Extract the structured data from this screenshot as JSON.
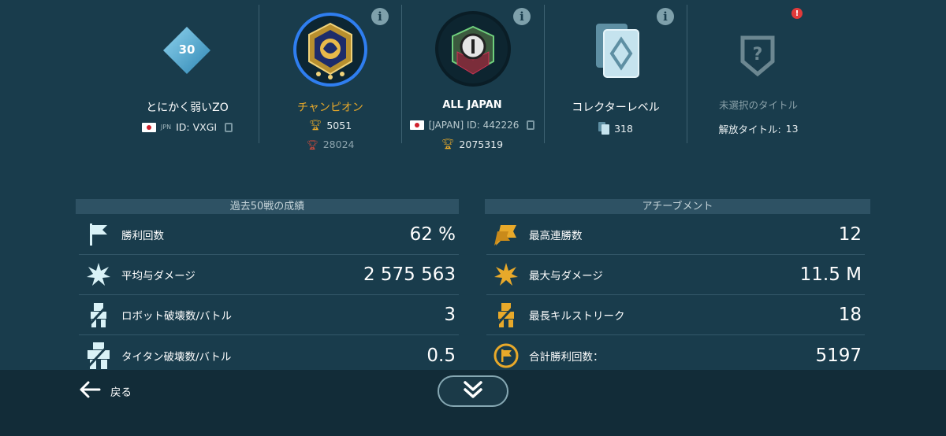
{
  "player": {
    "level": "30",
    "name": "とにかく弱いZO",
    "country_code": "JPN",
    "id_text": "ID: VXGI"
  },
  "league": {
    "name": "チャンピオン",
    "trophies": "5051",
    "best_trophies": "28024"
  },
  "clan": {
    "name": "ALL JAPAN",
    "id_text": "[JAPAN] ID: 442226",
    "trophies": "2075319"
  },
  "collector": {
    "title": "コレクターレベル",
    "value": "318"
  },
  "title_slot": {
    "label": "未選択のタイトル",
    "unlocked_label": "解放タイトル:",
    "unlocked_count": "13",
    "alert": "!"
  },
  "info_icon": "i",
  "last50": {
    "header": "過去50戦の成績",
    "rows": [
      {
        "label": "勝利回数",
        "value": "62 %",
        "icon": "flag-icon"
      },
      {
        "label": "平均与ダメージ",
        "value": "2 575 563",
        "icon": "explosion-icon"
      },
      {
        "label": "ロボット破壊数/バトル",
        "value": "3",
        "icon": "robot-icon"
      },
      {
        "label": "タイタン破壊数/バトル",
        "value": "0.5",
        "icon": "titan-icon"
      }
    ]
  },
  "achievements": {
    "header": "アチーブメント",
    "rows": [
      {
        "label": "最高連勝数",
        "value": "12",
        "icon": "flags-icon"
      },
      {
        "label": "最大与ダメージ",
        "value": "11.5 M",
        "icon": "explosion-icon"
      },
      {
        "label": "最長キルストリーク",
        "value": "18",
        "icon": "robot-icon"
      },
      {
        "label": "合計勝利回数：",
        "value": "5197",
        "icon": "flag-circle-icon"
      }
    ]
  },
  "nav": {
    "back_label": "戻る"
  },
  "colors": {
    "background": "#193c4c",
    "accent_gold": "#e8a92a",
    "league_ring": "#2f7ef0",
    "row_icon_light": "#d9f2f7"
  }
}
